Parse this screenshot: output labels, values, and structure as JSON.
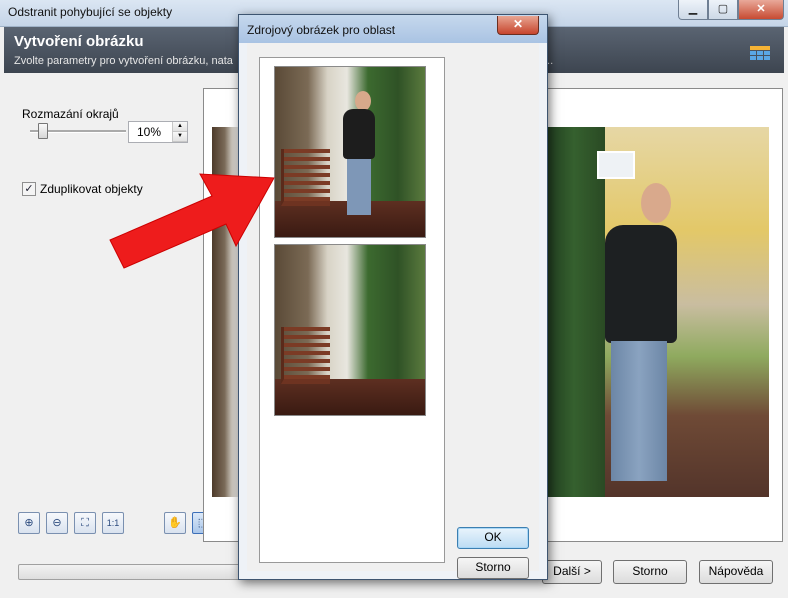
{
  "main_window": {
    "title": "Odstranit pohybující se objekty",
    "header_title": "Vytvoření obrázku",
    "header_subtitle": "Zvolte parametry pro vytvoření obrázku, nata",
    "header_subtitle_tail": "..."
  },
  "left_panel": {
    "blur_label": "Rozmazání okrajů",
    "blur_value": "10%",
    "blur_level_percent": 10,
    "duplicate_label": "Zduplikovat objekty",
    "duplicate_checked": true,
    "tools": [
      {
        "name": "zoom-in-icon",
        "glyph": "⊕"
      },
      {
        "name": "zoom-out-icon",
        "glyph": "⊖"
      },
      {
        "name": "fit-to-window-icon",
        "glyph": "⛶"
      },
      {
        "name": "actual-size-icon",
        "glyph": "1:1"
      },
      {
        "name": "hand-tool-icon",
        "glyph": "✋"
      },
      {
        "name": "selection-rect-icon",
        "glyph": "⬚"
      }
    ]
  },
  "dialog": {
    "title": "Zdrojový obrázek pro oblast",
    "close_glyph": "✕",
    "ok_label": "OK",
    "cancel_label": "Storno"
  },
  "footer": {
    "next_label": "Další >",
    "cancel_label": "Storno",
    "help_label": "Nápověda"
  },
  "window_controls": {
    "minimize": "▁",
    "maximize": "▢",
    "close": "✕"
  },
  "colors": {
    "accent_arrow": "#ee1c1c",
    "header_dark": "#4b5460",
    "dialog_title": "#b8cfe9"
  }
}
